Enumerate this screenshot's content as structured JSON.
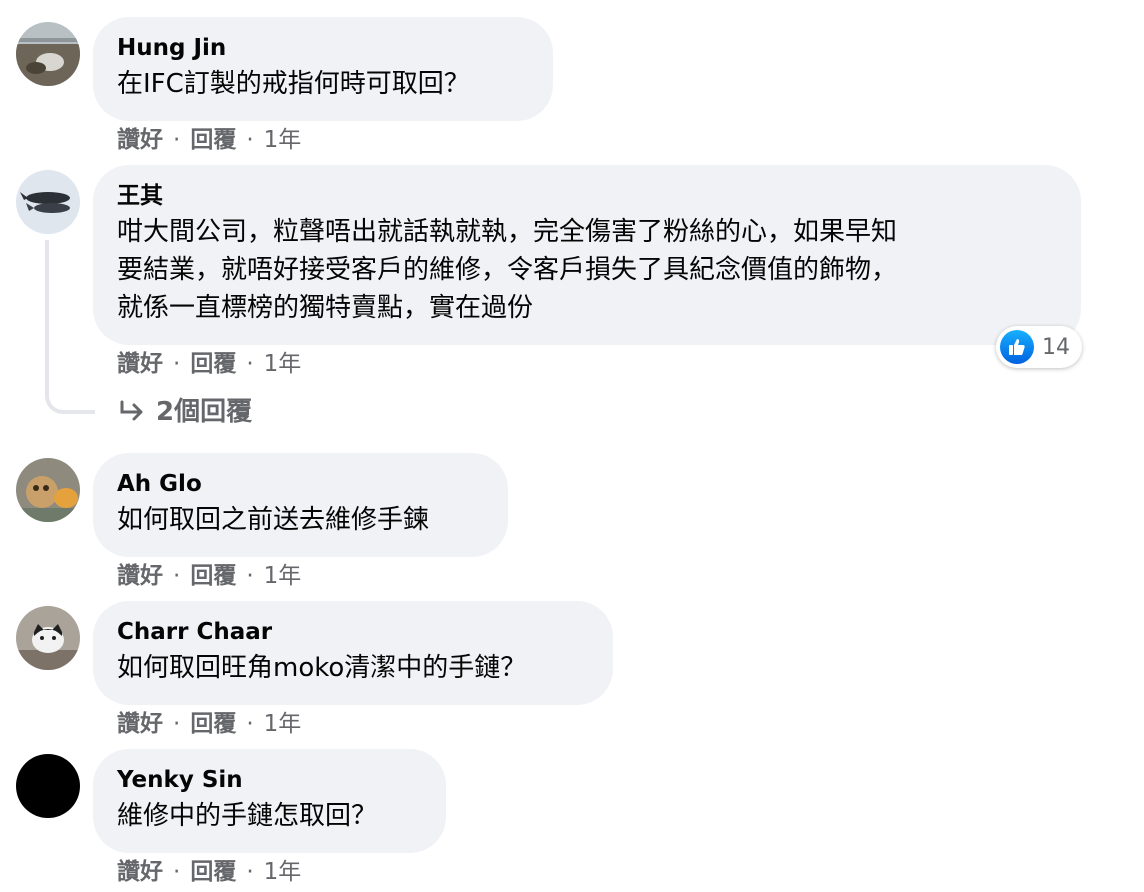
{
  "comments": [
    {
      "author": "Hung Jin",
      "text": "在IFC訂製的戒指何時可取回？",
      "like": "讚好",
      "reply": "回覆",
      "time": "1年"
    },
    {
      "author": "王其",
      "text": "咁大間公司，粒聲唔出就話執就執，完全傷害了粉絲的心，如果早知\n要結業，就唔好接受客戶的維修，令客戶損失了具紀念價值的飾物，\n就係一直標榜的獨特賣點，實在過份",
      "like": "讚好",
      "reply": "回覆",
      "time": "1年",
      "reaction_count": "14",
      "replies_label": "2個回覆"
    },
    {
      "author": "Ah Glo",
      "text": "如何取回之前送去維修手鍊",
      "like": "讚好",
      "reply": "回覆",
      "time": "1年"
    },
    {
      "author": "Charr Chaar",
      "text": "如何取回旺角moko清潔中的手鏈？",
      "like": "讚好",
      "reply": "回覆",
      "time": "1年"
    },
    {
      "author": "Yenky Sin",
      "text": "維修中的手鏈怎取回？",
      "like": "讚好",
      "reply": "回覆",
      "time": "1年"
    }
  ],
  "separator": "·",
  "icons": {
    "like": "thumbs-up-icon",
    "reply_arrow": "reply-arrow-icon"
  },
  "colors": {
    "bubble": "#f0f2f5",
    "meta": "#65676b",
    "like_blue": "#1877f2"
  }
}
